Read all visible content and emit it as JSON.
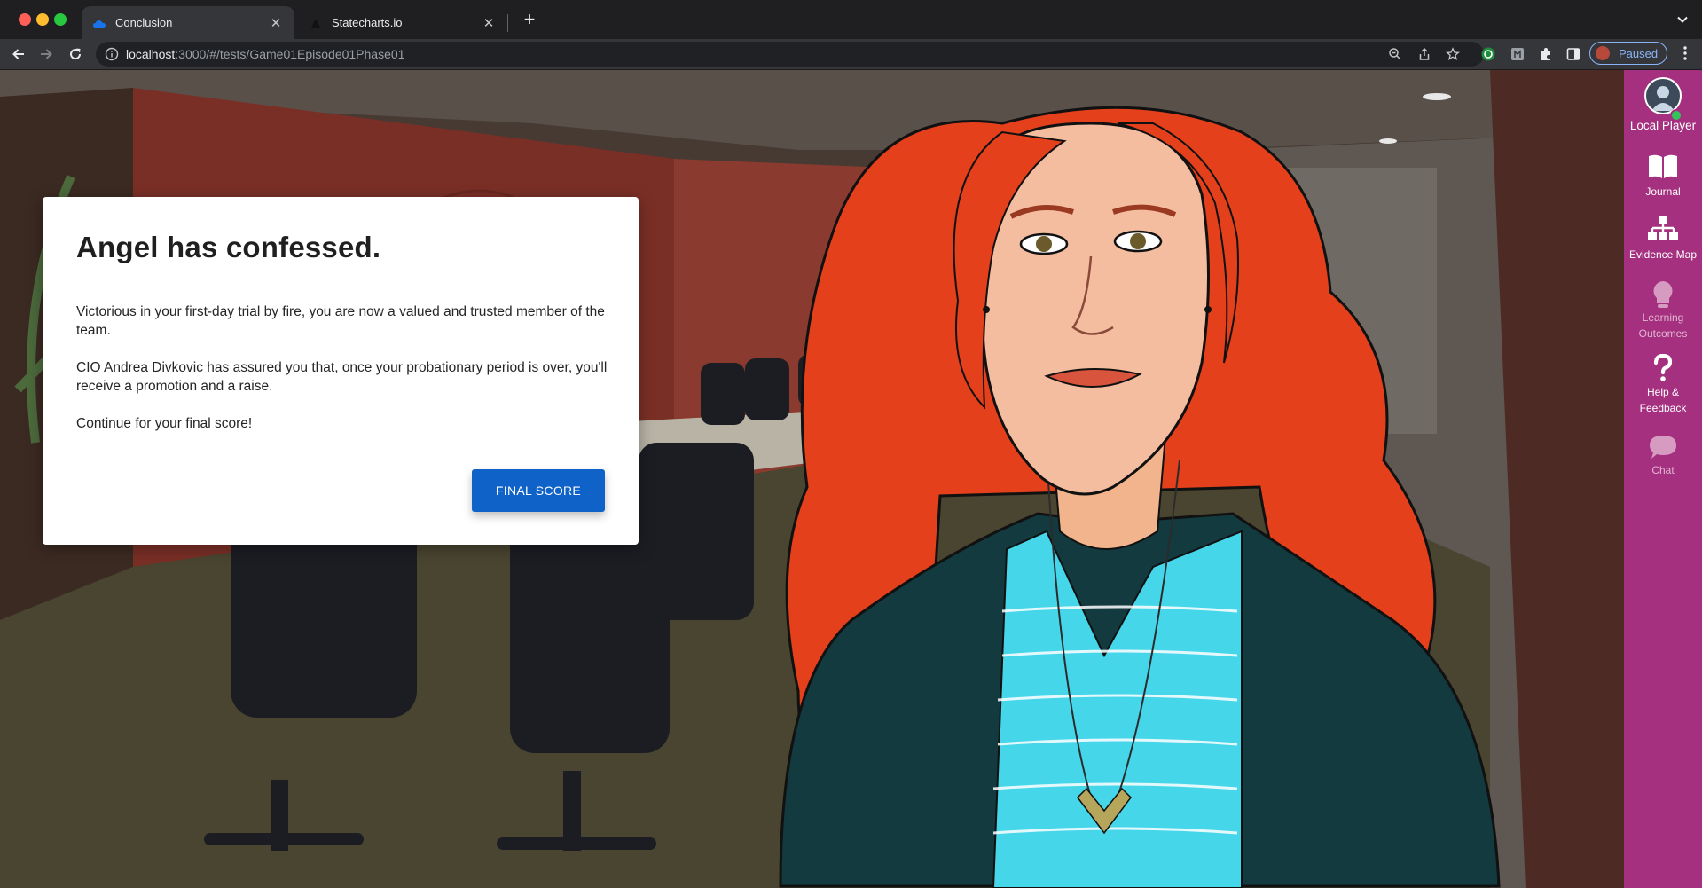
{
  "browser": {
    "tabs": [
      {
        "title": "Conclusion",
        "active": true,
        "favicon": "cloud-icon"
      },
      {
        "title": "Statecharts.io",
        "active": false,
        "favicon": "statecharts-icon"
      }
    ],
    "url_host": "localhost",
    "url_rest": ":3000/#/tests/Game01Episode01Phase01",
    "profile_label": "Paused"
  },
  "dialog": {
    "title": "Angel has confessed.",
    "paragraphs": [
      "Victorious in your first-day trial by fire, you are now a valued and trusted member of the team.",
      "CIO Andrea Divkovic has assured you that, once your probationary period is over, you'll receive a promotion and a raise.",
      "Continue for your final score!"
    ],
    "button_label": "FINAL SCORE"
  },
  "sidebar": {
    "player_label": "Local Player",
    "items": [
      {
        "label": "Journal",
        "icon": "book-icon",
        "enabled": true
      },
      {
        "label": "Evidence Map",
        "icon": "hierarchy-icon",
        "enabled": true
      },
      {
        "label": "Learning Outcomes",
        "icon": "lightbulb-icon",
        "enabled": false
      },
      {
        "label": "Help & Feedback",
        "icon": "question-icon",
        "enabled": true
      },
      {
        "label": "Chat",
        "icon": "chat-bubble-icon",
        "enabled": false
      }
    ]
  },
  "colors": {
    "sidebar": "#a4307f",
    "primary_button": "#0e62c8",
    "hair": "#e4401c",
    "shirt": "#45d6ea",
    "jacket": "#123a3f"
  }
}
